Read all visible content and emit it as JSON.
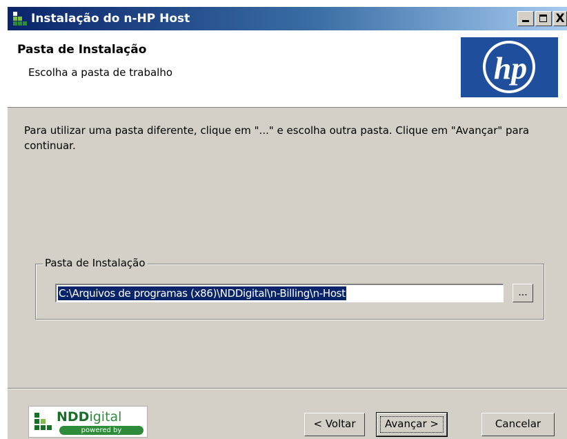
{
  "window": {
    "title": "Instalação do n-HP Host",
    "title_bar_color": "#0a246a",
    "close_glyph": "X"
  },
  "header": {
    "title": "Pasta de Instalação",
    "subtitle": "Escolha a pasta de trabalho",
    "logo_text": "hp",
    "logo_color": "#1f4e9c"
  },
  "main": {
    "instructions": "Para utilizar uma pasta diferente, clique em \"...\" e escolha outra pasta. Clique em \"Avançar\" para continuar.",
    "group_label": "Pasta de Instalação",
    "install_path": "C:\\Arquivos de programas (x86)\\NDDigital\\n-Billing\\n-Host",
    "browse_label": "..."
  },
  "footer": {
    "brand_prefix": "NDD",
    "brand_suffix": "igital",
    "brand_powered": "powered by",
    "brand_color": "#1b6d2a",
    "back_label": "< Voltar",
    "next_label": "Avançar >",
    "cancel_label": "Cancelar"
  },
  "icons": {
    "app": "setup-app-icon",
    "minimize": "minimize-icon",
    "maximize": "maximize-icon",
    "close": "close-icon"
  }
}
